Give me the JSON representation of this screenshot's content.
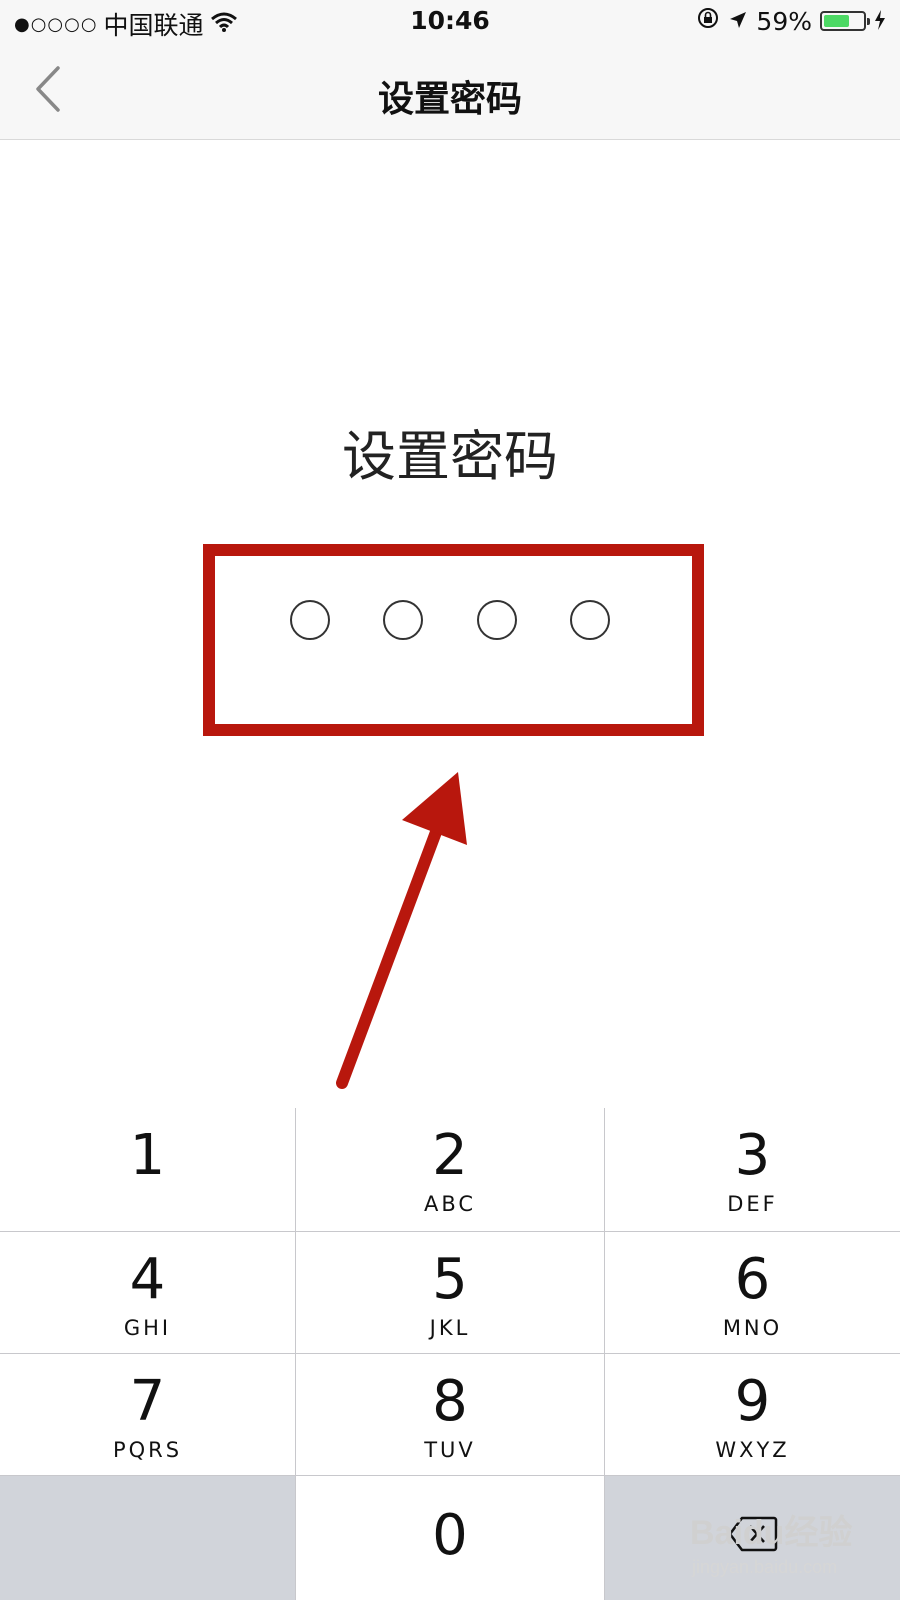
{
  "status_bar": {
    "signal": "●○○○○",
    "carrier": "中国联通",
    "time": "10:46",
    "battery_percent": "59%",
    "battery_level": 0.59,
    "battery_color": "#4cd964"
  },
  "nav": {
    "title": "设置密码",
    "back_icon": "chevron-left-icon"
  },
  "main": {
    "prompt": "设置密码",
    "pin_length": 4,
    "pin_entered": 0,
    "highlight_color": "#b8170d"
  },
  "keypad": {
    "keys": [
      {
        "digit": "1",
        "letters": ""
      },
      {
        "digit": "2",
        "letters": "ABC"
      },
      {
        "digit": "3",
        "letters": "DEF"
      },
      {
        "digit": "4",
        "letters": "GHI"
      },
      {
        "digit": "5",
        "letters": "JKL"
      },
      {
        "digit": "6",
        "letters": "MNO"
      },
      {
        "digit": "7",
        "letters": "PQRS"
      },
      {
        "digit": "8",
        "letters": "TUV"
      },
      {
        "digit": "9",
        "letters": "WXYZ"
      },
      {
        "digit": "0",
        "letters": ""
      }
    ],
    "delete_icon": "backspace-icon"
  },
  "watermark": {
    "main": "Baidu经验",
    "sub": "jingyan.baidu.com"
  }
}
